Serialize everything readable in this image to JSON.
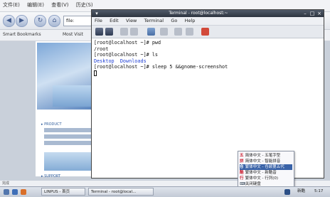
{
  "browser": {
    "menu": [
      "文件(E)",
      "编辑(E)",
      "查看(V)",
      "历史(S)"
    ],
    "url_text": "file:",
    "bookmarks": [
      "Smart Bookmarks",
      "Most Visit"
    ],
    "page_sections": [
      "▸ PRODUCT",
      "▸ SUPPORT"
    ],
    "status_text": "完成"
  },
  "terminal": {
    "title": "Terminal - root@localhost:~",
    "menu": [
      "File",
      "Edit",
      "View",
      "Terminal",
      "Go",
      "Help"
    ],
    "lines": [
      "[root@localhost ~]# pwd",
      "/root",
      "[root@localhost ~]# ls"
    ],
    "ls_output": [
      "Desktop",
      "Downloads"
    ],
    "last_prompt": "[root@localhost ~]# sleep 5 &&gnome-screenshot"
  },
  "ime_menu": {
    "items": [
      {
        "label": "简体中文 - 五笔字型",
        "icon": "五"
      },
      {
        "label": "简体中文 - 智能拼音",
        "icon": "拼"
      },
      {
        "label": "繁体中文 - 仓颉第五代",
        "icon": "仓"
      },
      {
        "label": "繁体中文 - 新酷音",
        "icon": "酷"
      },
      {
        "label": "繁体中文 - 行列(0)",
        "icon": "行"
      },
      {
        "label": "关闭键盘",
        "icon": "⌨"
      }
    ],
    "selected_index": 2
  },
  "taskbar": {
    "tasks": [
      "LINPUS - 首页",
      "Terminal - root@local..."
    ],
    "tray_text": "新酷",
    "clock": "5:17"
  }
}
